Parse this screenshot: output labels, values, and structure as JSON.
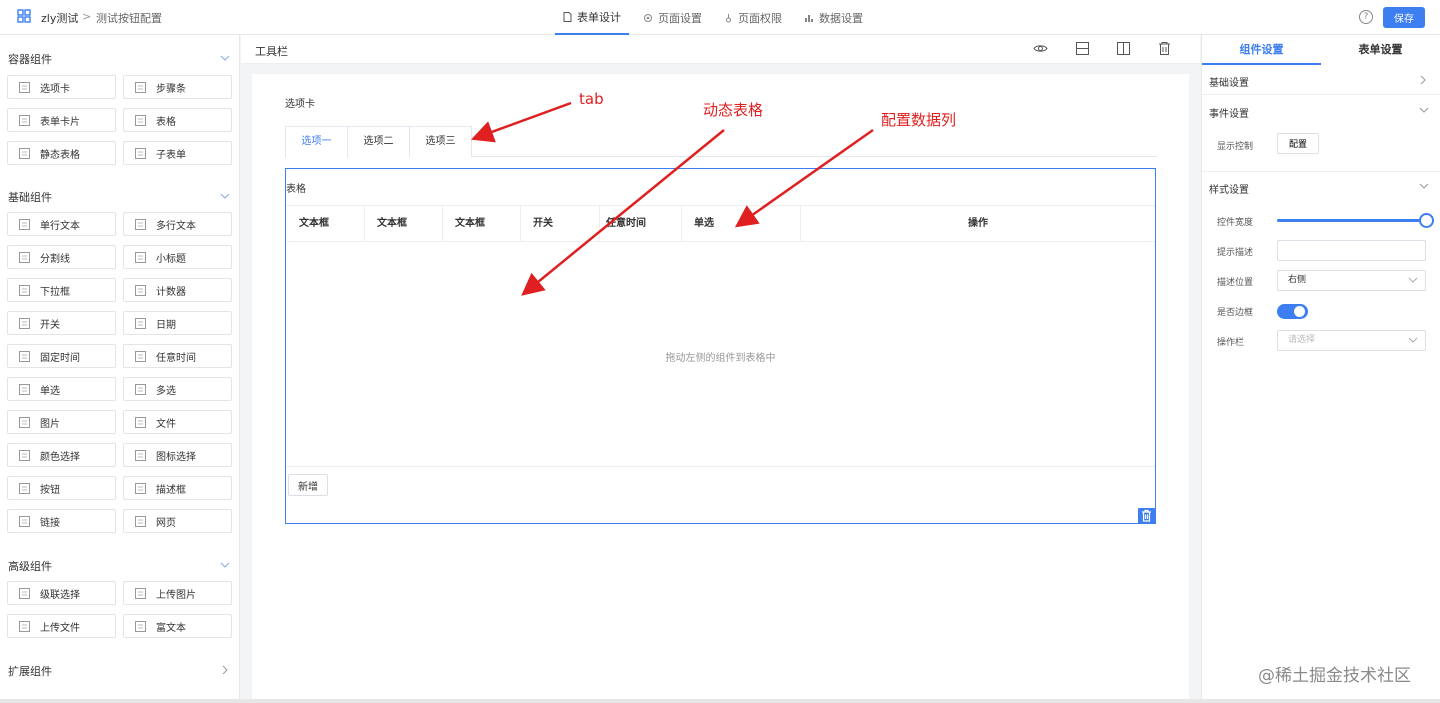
{
  "header": {
    "app_name": "zly测试",
    "separator": ">",
    "page_name": "测试按钮配置",
    "nav": [
      {
        "label": "表单设计",
        "icon": "file-icon",
        "active": true
      },
      {
        "label": "页面设置",
        "icon": "gear-icon",
        "active": false
      },
      {
        "label": "页面权限",
        "icon": "key-icon",
        "active": false
      },
      {
        "label": "数据设置",
        "icon": "bar-chart-icon",
        "active": false
      }
    ],
    "help_label": "?",
    "save_label": "保存"
  },
  "left": {
    "sections": [
      {
        "title": "容器组件",
        "items": [
          "选项卡",
          "步骤条",
          "表单卡片",
          "表格",
          "静态表格",
          "子表单"
        ]
      },
      {
        "title": "基础组件",
        "items": [
          "单行文本",
          "多行文本",
          "分割线",
          "小标题",
          "下拉框",
          "计数器",
          "开关",
          "日期",
          "固定时间",
          "任意时间",
          "单选",
          "多选",
          "图片",
          "文件",
          "颜色选择",
          "图标选择",
          "按钮",
          "描述框",
          "链接",
          "网页"
        ]
      },
      {
        "title": "高级组件",
        "items": [
          "级联选择",
          "上传图片",
          "上传文件",
          "富文本"
        ]
      },
      {
        "title": "扩展组件",
        "items": []
      }
    ]
  },
  "toolbar": {
    "title": "工具栏"
  },
  "canvas": {
    "tab_caption": "选项卡",
    "tabs": [
      "选项一",
      "选项二",
      "选项三"
    ],
    "table_caption": "表格",
    "columns": [
      "文本框",
      "文本框",
      "文本框",
      "开关",
      "任意时间",
      "单选",
      "操作"
    ],
    "empty_text": "拖动左侧的组件到表格中",
    "add_label": "新增"
  },
  "annotations": {
    "tab": "tab",
    "dynamic_table": "动态表格",
    "data_columns": "配置数据列"
  },
  "right": {
    "tabs": [
      "组件设置",
      "表单设置"
    ],
    "basic": "基础设置",
    "event": "事件设置",
    "display_control": "显示控制",
    "config_label": "配置",
    "style": "样式设置",
    "width_label": "控件宽度",
    "width_value": 1.0,
    "hint_label": "提示描述",
    "desc_pos_label": "描述位置",
    "desc_pos_value": "右侧",
    "border_label": "是否边框",
    "border_on": true,
    "action_label": "操作栏",
    "action_placeholder": "请选择"
  },
  "watermark": "@稀土掘金技术社区",
  "colors": {
    "accent": "#3d7ef0",
    "annotation": "#e02020"
  }
}
